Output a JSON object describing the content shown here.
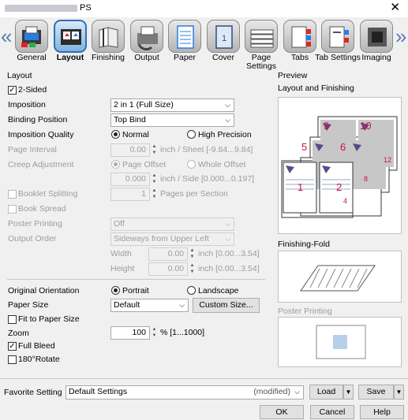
{
  "window": {
    "title": "PS",
    "close_glyph": "✕"
  },
  "toolbar": {
    "tabs": [
      {
        "label": "General",
        "icon": "general-icon"
      },
      {
        "label": "Layout",
        "icon": "layout-icon",
        "active": true
      },
      {
        "label": "Finishing",
        "icon": "finishing-icon"
      },
      {
        "label": "Output",
        "icon": "output-icon"
      },
      {
        "label": "Paper",
        "icon": "paper-icon"
      },
      {
        "label": "Cover",
        "icon": "cover-icon"
      },
      {
        "label": "Page Settings",
        "icon": "page-settings-icon"
      },
      {
        "label": "Tabs",
        "icon": "tabs-icon"
      },
      {
        "label": "Tab Settings",
        "icon": "tab-settings-icon"
      },
      {
        "label": "Imaging",
        "icon": "imaging-icon"
      }
    ],
    "prev": "«",
    "next": "»"
  },
  "layout": {
    "group_label": "Layout",
    "two_sided": {
      "label": "2-Sided",
      "checked": true
    },
    "imposition": {
      "label": "Imposition",
      "value": "2 in 1 (Full Size)"
    },
    "binding_position": {
      "label": "Binding Position",
      "value": "Top Bind"
    },
    "imposition_quality": {
      "label": "Imposition Quality",
      "normal": "Normal",
      "high": "High Precision",
      "selected": "Normal"
    },
    "page_interval": {
      "label": "Page Interval",
      "value": "0.00",
      "unit": "inch / Sheet [-9.84...9.84]"
    },
    "creep_adjustment": {
      "label": "Creep Adjustment",
      "opt1": "Page Offset",
      "opt2": "Whole Offset",
      "value": "0.000",
      "unit": "inch / Side [0.000...0.197]"
    },
    "booklet_splitting": {
      "label": "Booklet Splitting",
      "value": "1",
      "unit": "Pages per Section"
    },
    "book_spread": {
      "label": "Book Spread"
    },
    "poster_printing": {
      "label": "Poster Printing",
      "value": "Off"
    },
    "output_order": {
      "label": "Output Order",
      "value": "Sideways from Upper Left"
    },
    "width": {
      "label": "Width",
      "value": "0.00",
      "unit": "inch [0.00...3.54]"
    },
    "height": {
      "label": "Height",
      "value": "0.00",
      "unit": "inch [0.00...3.54]"
    },
    "original_orientation": {
      "label": "Original Orientation",
      "portrait": "Portrait",
      "landscape": "Landscape",
      "selected": "Portrait"
    },
    "paper_size": {
      "label": "Paper Size",
      "value": "Default",
      "custom_button": "Custom Size..."
    },
    "fit_to_paper": {
      "label": "Fit to Paper Size",
      "checked": false
    },
    "zoom": {
      "label": "Zoom",
      "value": "100",
      "unit": "% [1...1000]"
    },
    "full_bleed": {
      "label": "Full Bleed",
      "checked": true
    },
    "rotate180": {
      "label": "180°Rotate",
      "checked": false
    }
  },
  "preview": {
    "group_label": "Preview",
    "layout_finishing": "Layout and Finishing",
    "finishing_fold": "Finishing-Fold",
    "poster_printing": "Poster Printing",
    "page_numbers": [
      "9",
      "10",
      "5",
      "6",
      "1",
      "2",
      "12",
      "8",
      "4"
    ]
  },
  "footer": {
    "favorite_label": "Favorite Setting",
    "favorite_value": "Default Settings",
    "favorite_status": "(modified)",
    "load": "Load",
    "save": "Save",
    "ok": "OK",
    "cancel": "Cancel",
    "help": "Help"
  },
  "colors": {
    "accent": "#2e6fb4",
    "page_number": "#d0103a"
  }
}
